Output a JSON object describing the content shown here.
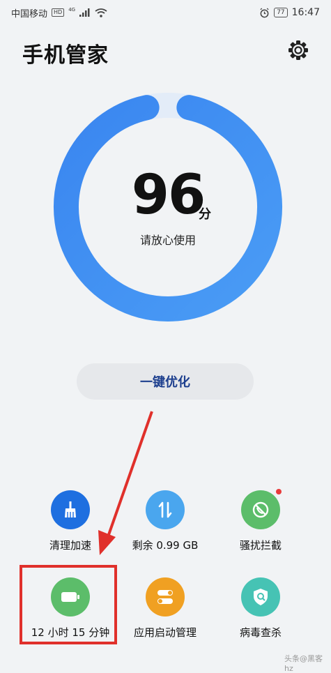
{
  "status": {
    "carrier": "中国移动",
    "hd": "HD",
    "net": "4G",
    "battery": "77",
    "time": "16:47"
  },
  "header": {
    "title": "手机管家"
  },
  "score": {
    "value": "96",
    "unit": "分",
    "caption": "请放心使用",
    "fraction": 0.96
  },
  "optimize_label": "一键优化",
  "tools": [
    {
      "label": "清理加速",
      "color": "#1e6fe0",
      "icon": "broom-icon"
    },
    {
      "label": "剩余 0.99 GB",
      "color": "#4aa6ee",
      "icon": "transfer-arrows-icon"
    },
    {
      "label": "骚扰拦截",
      "color": "#5cbd6a",
      "icon": "blocked-call-icon"
    },
    {
      "label": "12 小时 15 分钟",
      "color": "#5cbd6a",
      "icon": "battery-icon"
    },
    {
      "label": "应用启动管理",
      "color": "#f0a022",
      "icon": "toggle-switch-icon"
    },
    {
      "label": "病毒查杀",
      "color": "#46c3b4",
      "icon": "shield-search-icon"
    }
  ],
  "watermark": "头条@黑客hz"
}
